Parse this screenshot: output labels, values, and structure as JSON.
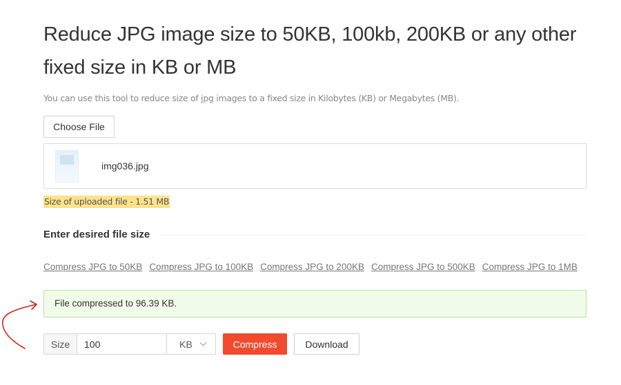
{
  "page": {
    "title": "Reduce JPG image size to 50KB, 100kb, 200KB or any other fixed size in KB or MB",
    "subtitle": "You can use this tool to reduce size of jpg images to a fixed size in Kilobytes (KB) or Megabytes (MB)."
  },
  "upload": {
    "choose_label": "Choose File",
    "file_name": "img036.jpg",
    "size_note": "Size of uploaded file - 1.51 MB"
  },
  "section": {
    "heading": "Enter desired file size"
  },
  "links": [
    "Compress JPG to 50KB",
    "Compress JPG to 100KB",
    "Compress JPG to 200KB",
    "Compress JPG to 500KB",
    "Compress JPG to 1MB"
  ],
  "result": {
    "message": "File compressed to 96.39 KB."
  },
  "controls": {
    "size_label": "Size",
    "size_value": "100",
    "unit": "KB",
    "compress_label": "Compress",
    "download_label": "Download"
  },
  "colors": {
    "accent": "#f24a2e",
    "highlight": "#fde28a",
    "success_bg": "#f1fbe9",
    "success_border": "#b8e39a",
    "annotation": "#d0241b"
  }
}
